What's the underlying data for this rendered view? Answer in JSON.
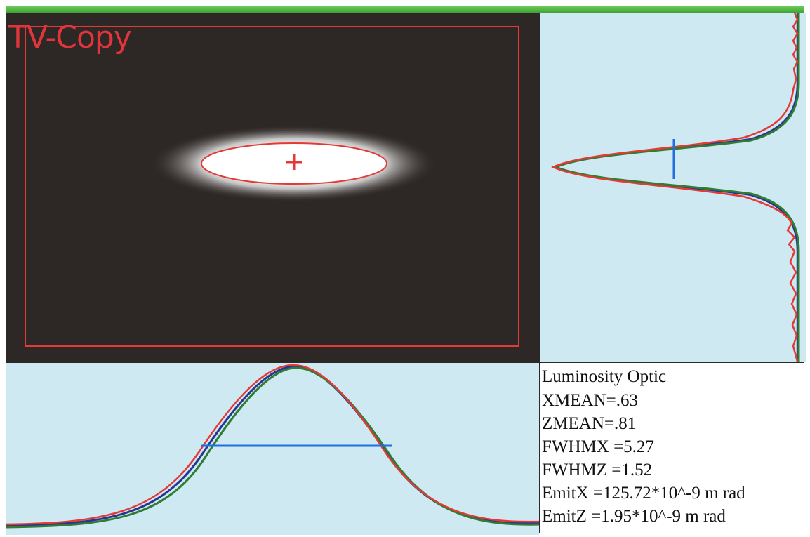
{
  "window": {
    "accent_green": "#4caf3f"
  },
  "tv_view": {
    "title": "TV-Copy",
    "overlay_color": "#e53935",
    "beam_marker": "plus-icon"
  },
  "info": {
    "heading": "Luminosity Optic",
    "lines": [
      "XMEAN=.63",
      "ZMEAN=.81",
      "FWHMX =5.27",
      "FWHMZ =1.52",
      "EmitX =125.72*10^-9 m rad",
      "EmitZ =1.95*10^-9 m rad"
    ]
  },
  "profiles": {
    "colors": {
      "measured": "#e53935",
      "fit": "#2e7d32",
      "reference": "#283593",
      "fwhm": "#1e6fe0"
    }
  }
}
